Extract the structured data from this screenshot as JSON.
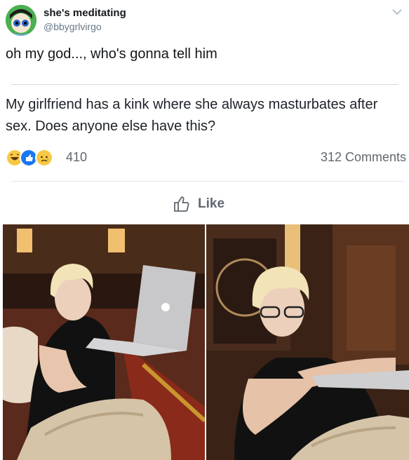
{
  "tweet": {
    "display_name": "she's meditating",
    "handle": "@bbygrlvirgo",
    "text": "oh my god..., who's gonna tell him"
  },
  "facebook_post": {
    "text": "My girlfriend has a kink where she always masturbates after sex. Does anyone else have this?",
    "reactions": [
      "haha-icon",
      "like-icon",
      "sad-icon"
    ],
    "reaction_count": "410",
    "comments_count": "312 Comments",
    "like_button_label": "Like"
  },
  "photos": [
    {
      "name": "photo-left",
      "subject": "woman with laptop on couch"
    },
    {
      "name": "photo-right",
      "subject": "woman with glasses and laptop"
    }
  ],
  "colors": {
    "text_primary": "#14171a",
    "text_secondary": "#657786",
    "fb_gray": "#606770",
    "like_blue": "#1877f2",
    "reaction_yellow": "#f7c843"
  }
}
